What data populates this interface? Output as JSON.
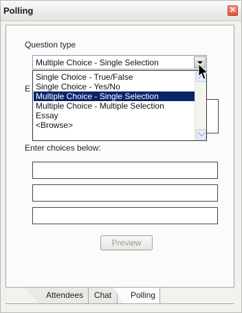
{
  "window": {
    "title": "Polling",
    "close_glyph": "✕"
  },
  "question_type": {
    "label": "Question type",
    "selected": "Multiple Choice - Single Selection",
    "options": [
      "Single Choice   - True/False",
      "Single Choice   - Yes/No",
      "Multiple Choice - Single Selection",
      "Multiple Choice - Multiple Selection",
      "Essay",
      "<Browse>"
    ],
    "selected_index": 2
  },
  "question_label_partial": "E",
  "choices": {
    "label": "Enter choices below:",
    "values": [
      "",
      "",
      ""
    ]
  },
  "preview_button": "Preview",
  "tabs": [
    "Attendees",
    "Chat",
    "Polling"
  ],
  "colors": {
    "selection": "#0a246a",
    "close": "#e5533c"
  }
}
